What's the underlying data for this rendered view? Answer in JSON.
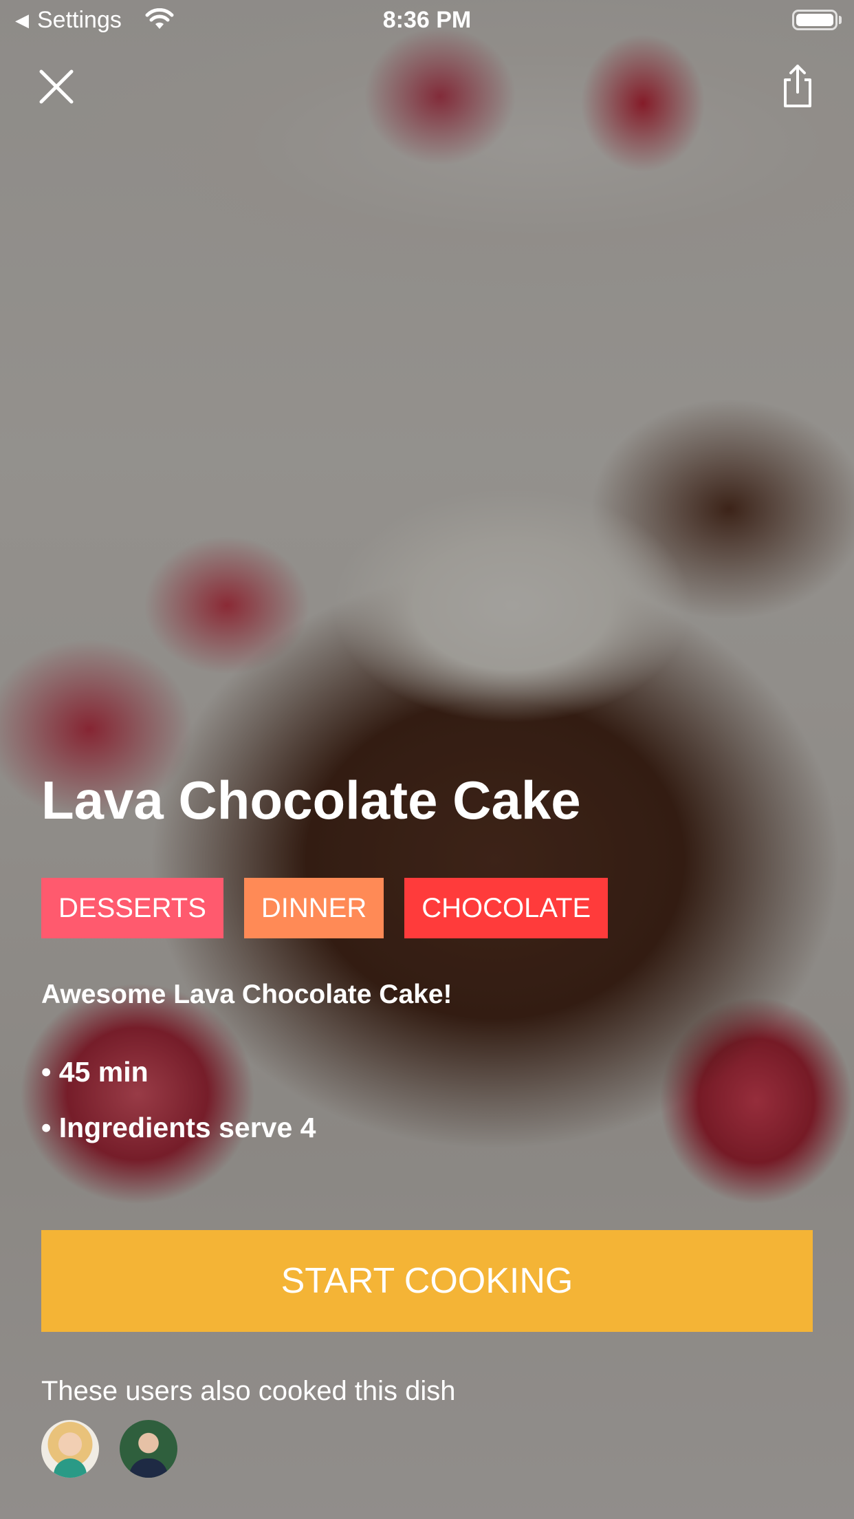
{
  "status_bar": {
    "back_app": "Settings",
    "time": "8:36 PM"
  },
  "nav": {
    "close_icon": "close-icon",
    "share_icon": "share-icon"
  },
  "recipe": {
    "title": "Lava Chocolate Cake",
    "tags": [
      {
        "label": "DESSERTS",
        "color": "#ff5a6e"
      },
      {
        "label": "DINNER",
        "color": "#ff8a56"
      },
      {
        "label": "CHOCOLATE",
        "color": "#ff3b3b"
      }
    ],
    "description": "Awesome Lava Chocolate Cake!",
    "time": "• 45 min",
    "servings": "• Ingredients serve 4"
  },
  "actions": {
    "start_cooking": "START COOKING",
    "accent_color": "#f4b436"
  },
  "social": {
    "also_cooked": "These users also cooked this dish"
  }
}
